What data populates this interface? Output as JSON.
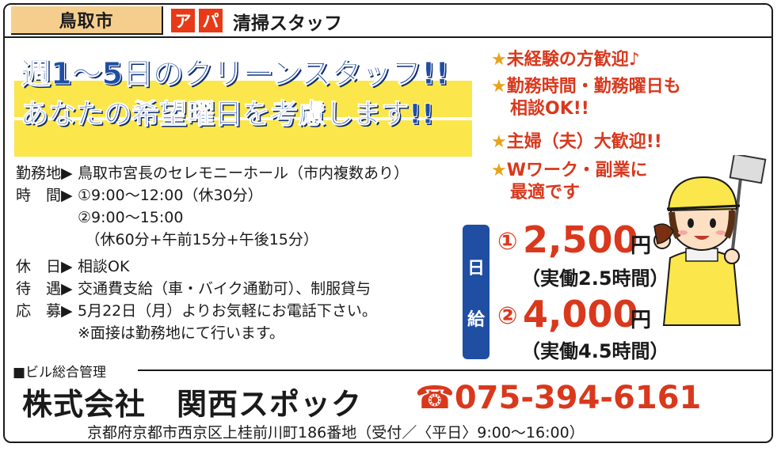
{
  "header": {
    "location": "鳥取市",
    "badges": [
      "ア",
      "パ"
    ],
    "job_title": "清掃スタッフ",
    "badge_color": "#e83a16",
    "tab_color": "#f5ce8e"
  },
  "headline": {
    "line1": "週1〜5日のクリーンスタッフ!!",
    "line2": "あなたの希望曜日を考慮します!!",
    "text_color": "#1f4ea3",
    "highlight_color": "#fbe64c"
  },
  "info": [
    {
      "key": "勤務地▶",
      "value": "鳥取市宮長のセレモニーホール（市内複数あり）"
    },
    {
      "key": "時　間▶",
      "value": "①9:00〜12:00（休30分）"
    },
    {
      "key": "",
      "value": "②9:00〜15:00"
    },
    {
      "key": "",
      "value": "　（休60分+午前15分+午後15分）"
    },
    {
      "key": "休　日▶",
      "value": "相談OK"
    },
    {
      "key": "待　遇▶",
      "value": "交通費支給（車・バイク通勤可）、制服貸与"
    },
    {
      "key": "応　募▶",
      "value": "5月22日（月）よりお気軽にお電話下さい。"
    },
    {
      "key": "",
      "value": "※面接は勤務地にて行います。"
    }
  ],
  "bullets": [
    {
      "star": "★",
      "lines": [
        "未経験の方歓迎♪"
      ]
    },
    {
      "star": "★",
      "lines": [
        "勤務時間・勤務曜日も",
        "相談OK!!"
      ]
    },
    {
      "star": "★",
      "lines": [
        "主婦（夫）大歓迎!!"
      ]
    },
    {
      "star": "★",
      "lines": [
        "Wワーク・副業に",
        "最適です"
      ]
    }
  ],
  "pay": {
    "label_chars": [
      "日",
      "給"
    ],
    "items": [
      {
        "mark": "①",
        "amount": "2,500",
        "unit": "円",
        "note": "（実働2.5時間）"
      },
      {
        "mark": "②",
        "amount": "4,000",
        "unit": "円",
        "note": "（実働4.5時間）"
      }
    ]
  },
  "footer": {
    "management": "■ビル総合管理",
    "company": "株式会社　関西スポック",
    "phone_icon": "☎",
    "phone": "075-394-6161",
    "address": "京都府京都市西京区上桂前川町186番地（受付／〈平日〉9:00〜16:00）"
  },
  "illustration": {
    "name": "cleaning-staff-character"
  }
}
